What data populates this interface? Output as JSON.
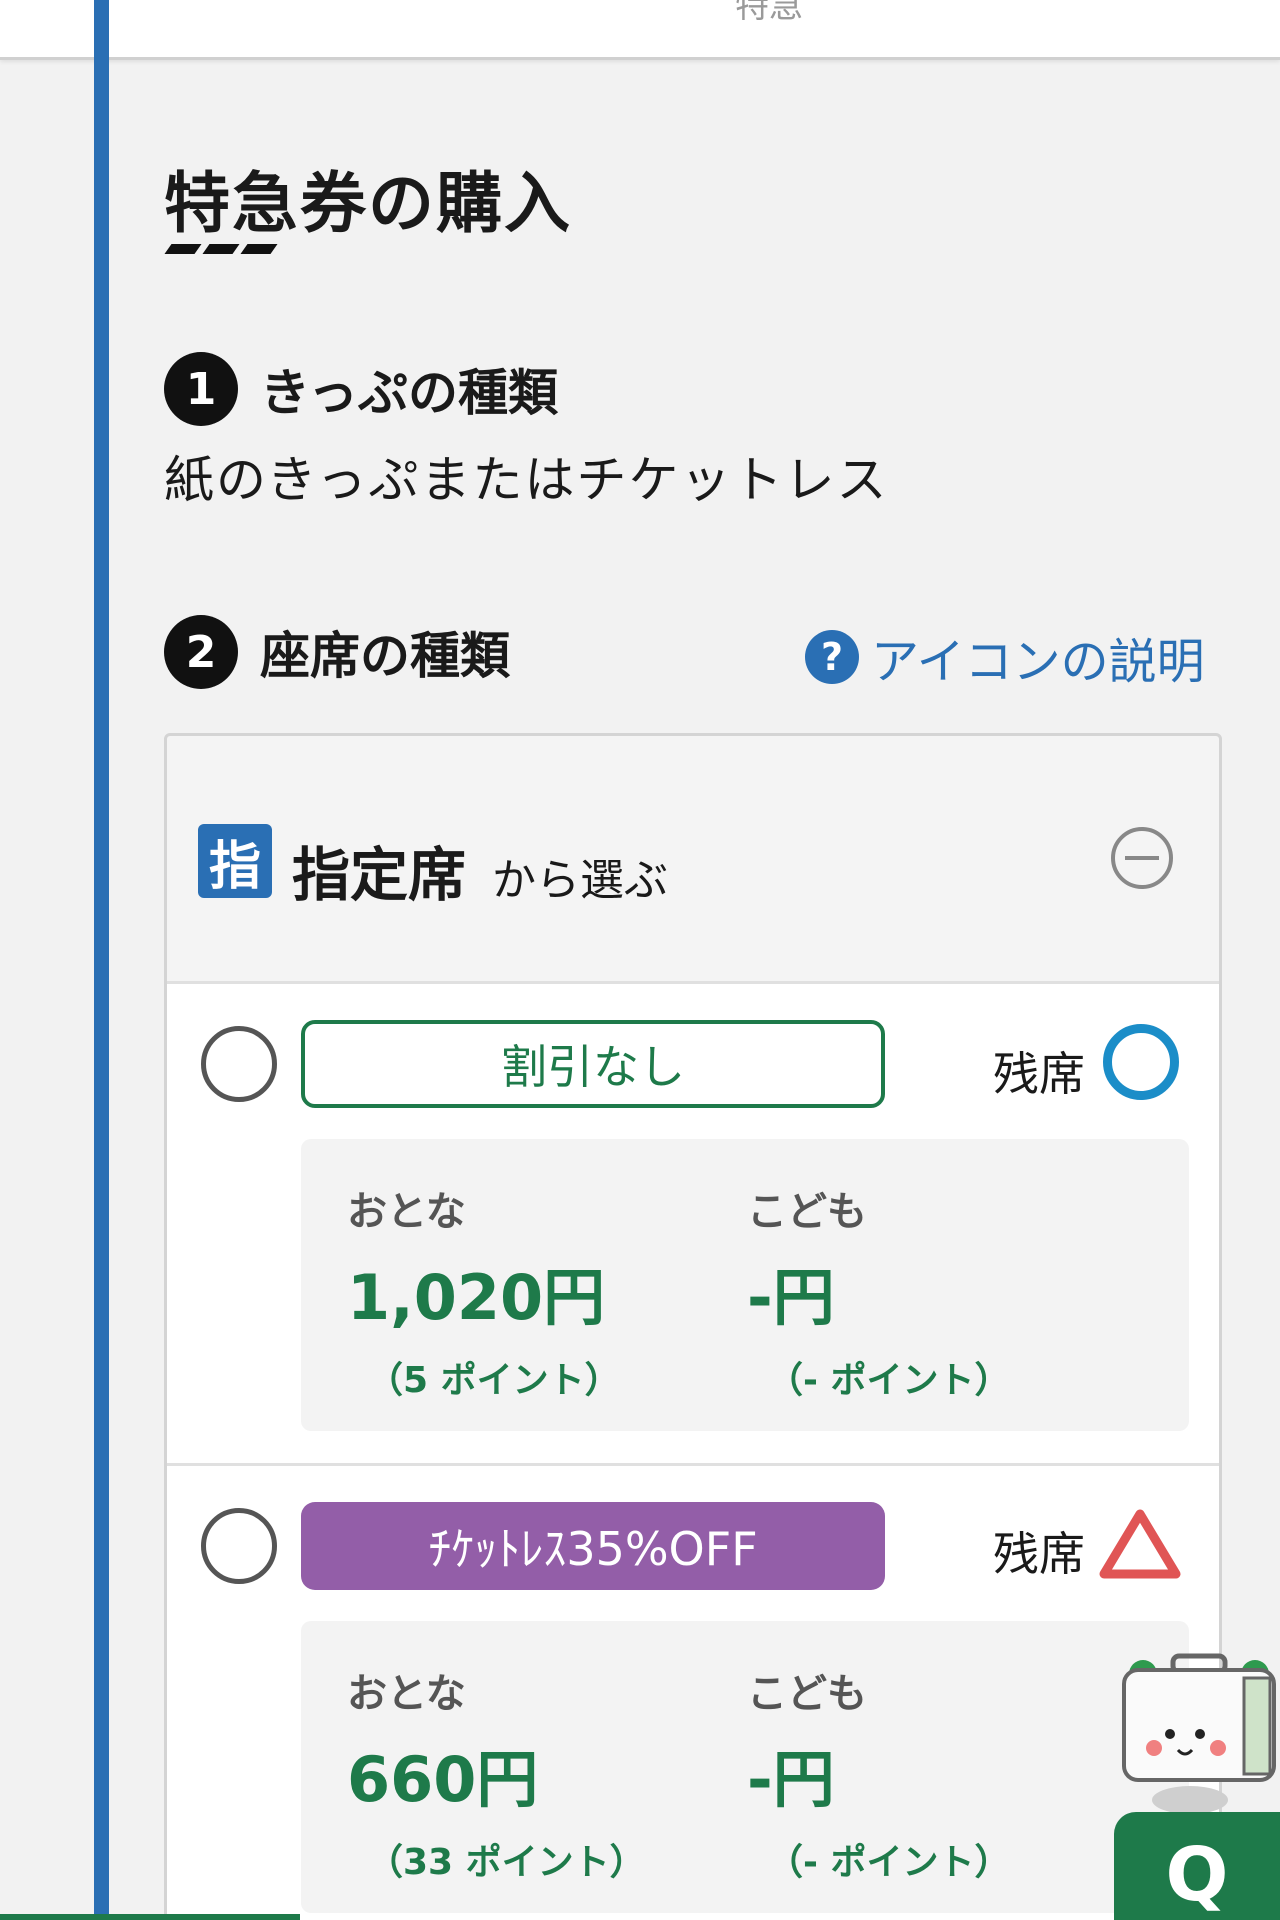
{
  "header": {
    "peek_text": "特急"
  },
  "page": {
    "title": "特急券の購入"
  },
  "steps": [
    {
      "number": "1",
      "label": "きっぷの種類",
      "value": "紙のきっぷまたはチケットレス"
    },
    {
      "number": "2",
      "label": "座席の種類"
    }
  ],
  "help": {
    "icon": "question-icon",
    "glyph": "?",
    "label": "アイコンの説明"
  },
  "seat_group": {
    "badge": "指",
    "type": "指定席",
    "sub": "から選ぶ",
    "toggle_icon": "minus-circle-icon"
  },
  "options": [
    {
      "plan": "割引なし",
      "availability_label": "残席",
      "availability_icon": "circle-available-icon",
      "adult_label": "おとな",
      "adult_price": "1,020円",
      "adult_points": "（5 ポイント）",
      "child_label": "こども",
      "child_price": "-円",
      "child_points": "（- ポイント）"
    },
    {
      "plan": "ﾁｹｯﾄﾚｽ35%OFF",
      "availability_label": "残席",
      "availability_icon": "triangle-few-icon",
      "adult_label": "おとな",
      "adult_price": "660円",
      "adult_points": "（33 ポイント）",
      "child_label": "こども",
      "child_price": "-円",
      "child_points": "（- ポイント）"
    }
  ],
  "chat": {
    "label": "Q"
  },
  "colors": {
    "blue": "#2a6fb4",
    "green": "#1e7a4a",
    "purple": "#935ea8",
    "avail_blue": "#1b8dc8",
    "avail_red": "#e05555"
  }
}
